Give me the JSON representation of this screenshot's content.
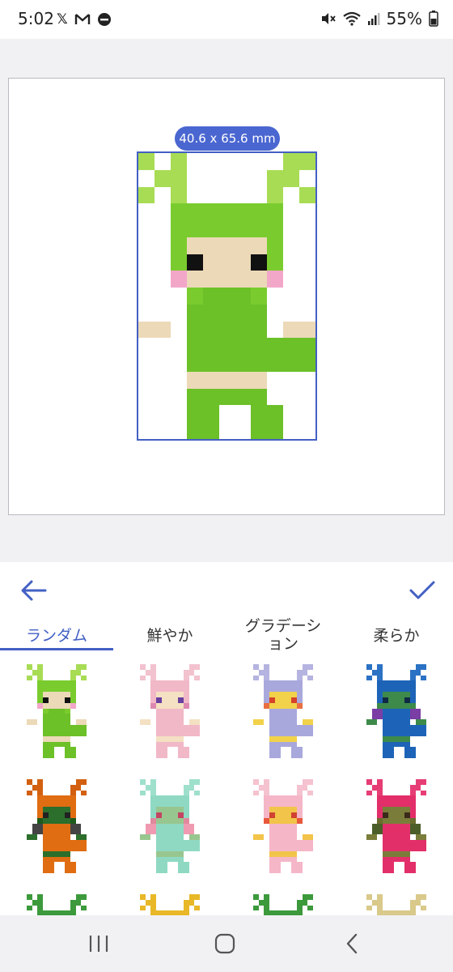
{
  "status_bar": {
    "time": "5:02",
    "battery": "55%",
    "left_icons": [
      "x-icon",
      "gmail-icon",
      "dnd-icon"
    ],
    "right_icons": [
      "mute-icon",
      "wifi-icon",
      "signal-icon",
      "battery-icon"
    ]
  },
  "preview": {
    "size_label": "40.6 x 65.6 mm"
  },
  "toolbar": {
    "back_icon": "arrow-left-icon",
    "confirm_icon": "checkmark-icon"
  },
  "tabs": [
    {
      "label": "ランダム",
      "selected": true
    },
    {
      "label": "鮮やか",
      "selected": false
    },
    {
      "label_line1": "グラデーシ",
      "label_line2": "ョン",
      "selected": false
    },
    {
      "label": "柔らか",
      "selected": false
    }
  ],
  "colors": {
    "accent": "#4360c4",
    "badge": "#4a66d0"
  },
  "variations": [
    {
      "hair": "#7acc2e",
      "leaf": "#a8dc55",
      "skin": "#ecd9b8",
      "sleeve": "#ffffff",
      "dress": "#6cc028",
      "cheek": "#f2a7c9",
      "eye": "#111111",
      "shoe": "#6cc028"
    },
    {
      "hair": "#f1b8c8",
      "leaf": "#f2c2cf",
      "skin": "#f4e0c2",
      "sleeve": "#ffffff",
      "dress": "#f1b8c8",
      "cheek": "#dd88b0",
      "eye": "#6a3fa0",
      "shoe": "#f1b8c8"
    },
    {
      "hair": "#a9a8dc",
      "leaf": "#b5b3e0",
      "skin": "#f2d24a",
      "sleeve": "#ffffff",
      "dress": "#a9a8dc",
      "cheek": "#e96f43",
      "eye": "#d6422a",
      "shoe": "#a9a8dc"
    },
    {
      "hair": "#1d64b8",
      "leaf": "#2b72c4",
      "skin": "#3d8a4a",
      "sleeve": "#7a3ea5",
      "dress": "#1d64b8",
      "cheek": "#3d8a4a",
      "eye": "#0f2a44",
      "shoe": "#1d64b8"
    },
    {
      "hair": "#e06d12",
      "leaf": "#d26010",
      "skin": "#2c6e2c",
      "sleeve": "#444444",
      "dress": "#e06d12",
      "cheek": "#1d5a1d",
      "eye": "#222222",
      "shoe": "#e06d12"
    },
    {
      "hair": "#8fd9c3",
      "leaf": "#9fe0cc",
      "skin": "#98c68f",
      "sleeve": "#ef9ab0",
      "dress": "#8fd9c3",
      "cheek": "#e0899e",
      "eye": "#c34564",
      "shoe": "#8fd9c3"
    },
    {
      "hair": "#f5b7c8",
      "leaf": "#f5c2cf",
      "skin": "#f2c44a",
      "sleeve": "#ffffff",
      "dress": "#f5b7c8",
      "cheek": "#e8583d",
      "eye": "#d04232",
      "shoe": "#f5b7c8"
    },
    {
      "hair": "#e22f6a",
      "leaf": "#e63d74",
      "skin": "#7a7d3a",
      "sleeve": "#4b5e2a",
      "dress": "#e22f6a",
      "cheek": "#6a6c2e",
      "eye": "#3a2a1a",
      "shoe": "#e22f6a"
    },
    {
      "hair": "#3c9a3c",
      "leaf": "#3c9a3c",
      "skin": "#3c9a3c",
      "sleeve": "#3c9a3c",
      "dress": "#3c9a3c",
      "cheek": "#3c9a3c",
      "eye": "#3c9a3c",
      "shoe": "#3c9a3c"
    },
    {
      "hair": "#e8b828",
      "leaf": "#e8b828",
      "skin": "#e8b828",
      "sleeve": "#e8b828",
      "dress": "#e8b828",
      "cheek": "#e8b828",
      "eye": "#e8b828",
      "shoe": "#e8b828"
    },
    {
      "hair": "#3c9a3c",
      "leaf": "#3c9a3c",
      "skin": "#3c9a3c",
      "sleeve": "#3c9a3c",
      "dress": "#3c9a3c",
      "cheek": "#3c9a3c",
      "eye": "#3c9a3c",
      "shoe": "#3c9a3c"
    },
    {
      "hair": "#d9c98a",
      "leaf": "#d9c98a",
      "skin": "#d9c98a",
      "sleeve": "#d9c98a",
      "dress": "#d9c98a",
      "cheek": "#d9c98a",
      "eye": "#d9c98a",
      "shoe": "#d9c98a"
    }
  ],
  "navbar": {
    "recents_icon": "recents-icon",
    "home_icon": "home-icon",
    "back_icon": "back-chevron-icon"
  }
}
